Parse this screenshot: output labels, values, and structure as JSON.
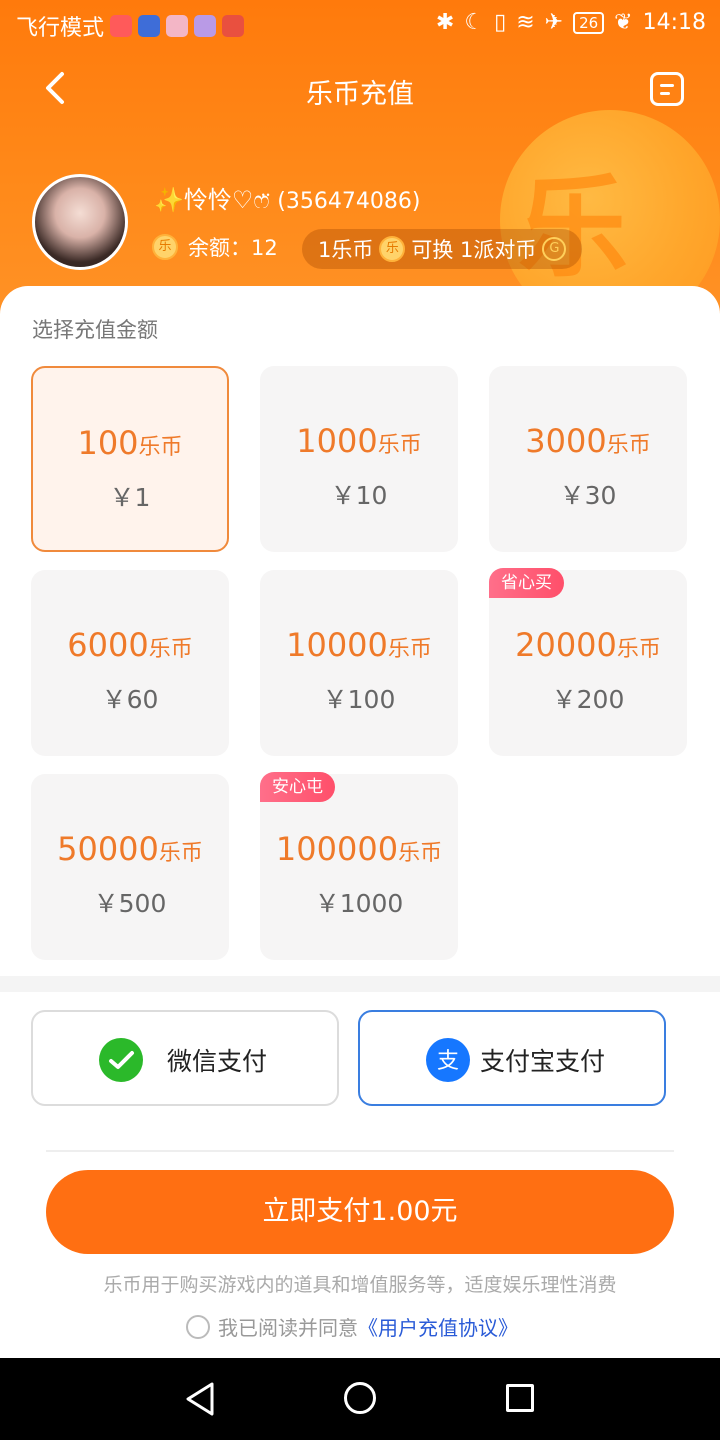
{
  "status_bar": {
    "left_text": "飞行模式",
    "battery": "26",
    "time": "14:18"
  },
  "nav": {
    "title": "乐币充值"
  },
  "coin_char": "乐",
  "user": {
    "name": "✨怜怜♡ෆ̈",
    "uid": "(356474086)",
    "balance_label": "余额：12",
    "exchange_left": "1乐币",
    "exchange_mid": "可换 1派对币"
  },
  "section_label": "选择充值金额",
  "options": [
    {
      "coins": "100",
      "unit": "乐币",
      "price": "￥1"
    },
    {
      "coins": "1000",
      "unit": "乐币",
      "price": "￥10"
    },
    {
      "coins": "3000",
      "unit": "乐币",
      "price": "￥30"
    },
    {
      "coins": "6000",
      "unit": "乐币",
      "price": "￥60"
    },
    {
      "coins": "10000",
      "unit": "乐币",
      "price": "￥100"
    },
    {
      "coins": "20000",
      "unit": "乐币",
      "price": "￥200",
      "badge": "省心买"
    },
    {
      "coins": "50000",
      "unit": "乐币",
      "price": "￥500"
    },
    {
      "coins": "100000",
      "unit": "乐币",
      "price": "￥1000",
      "badge": "安心屯"
    }
  ],
  "payment": {
    "wechat_label": "微信支付",
    "alipay_label": "支付宝支付"
  },
  "submit_label": "立即支付1.00元",
  "notice": "乐币用于购买游戏内的道具和增值服务等，适度娱乐理性消费",
  "agree": {
    "text": "我已阅读并同意",
    "link": "《用户充值协议》"
  },
  "colors": {
    "brand_orange": "#ff7a0c",
    "price_orange": "#ef7a2a",
    "alipay_blue": "#3a7ee0",
    "wechat_green": "#2bb92a"
  }
}
